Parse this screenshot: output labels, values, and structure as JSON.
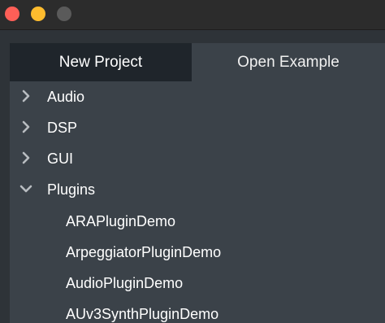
{
  "window": {
    "traffic_lights": {
      "close_color": "#fe5f57",
      "minimize_color": "#febc2e",
      "zoom_color": "#5a5a5a"
    }
  },
  "tabs": [
    {
      "label": "New Project",
      "active": true
    },
    {
      "label": "Open Example",
      "active": false
    }
  ],
  "tree": {
    "categories": [
      {
        "label": "Audio",
        "expanded": false,
        "icon": "chevron-right-icon"
      },
      {
        "label": "DSP",
        "expanded": false,
        "icon": "chevron-right-icon"
      },
      {
        "label": "GUI",
        "expanded": false,
        "icon": "chevron-right-icon"
      },
      {
        "label": "Plugins",
        "expanded": true,
        "icon": "chevron-down-icon"
      }
    ],
    "plugin_children": [
      {
        "label": "ARAPluginDemo"
      },
      {
        "label": "ArpeggiatorPluginDemo"
      },
      {
        "label": "AudioPluginDemo"
      },
      {
        "label": "AUv3SynthPluginDemo"
      }
    ]
  },
  "colors": {
    "titlebar": "#2c2c2c",
    "panel": "#3b4249",
    "active_tab": "#1f252b",
    "chevron": "#b8bcc0",
    "text": "#ffffff"
  }
}
